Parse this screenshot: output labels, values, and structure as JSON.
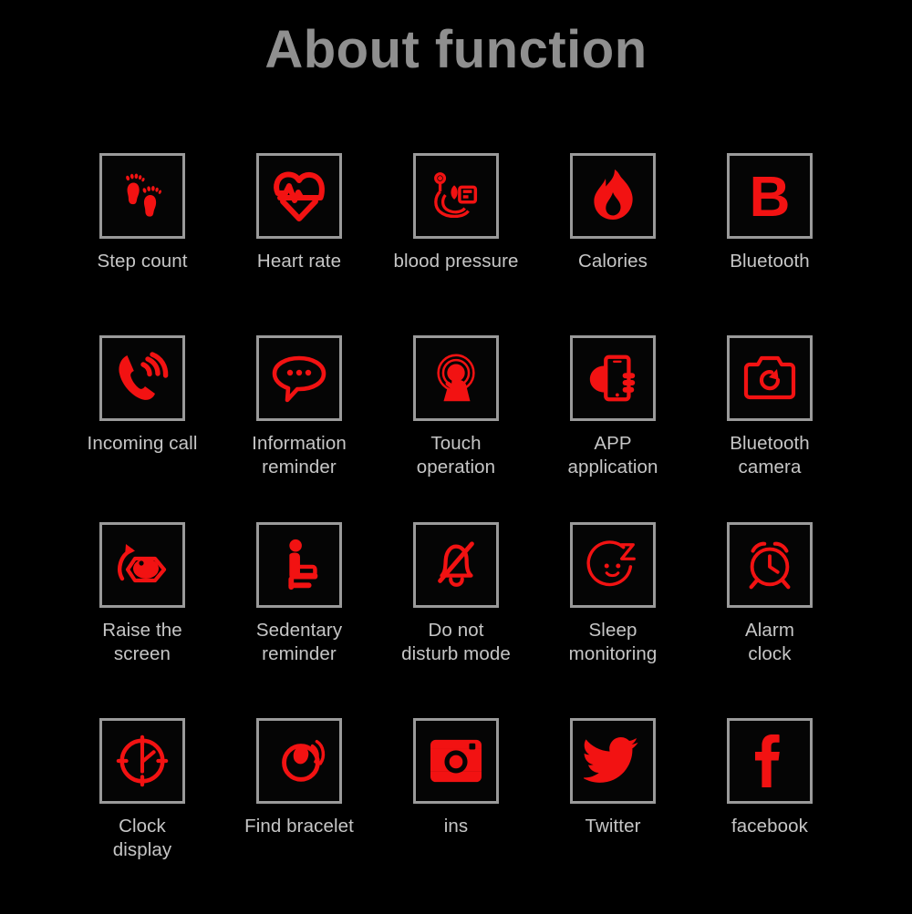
{
  "page": {
    "title": "About function",
    "background_color": "#000000",
    "title_color": "#8f8f8f",
    "label_color": "#c6c6c6",
    "icon_color": "#f21212",
    "icon_border_color": "#9a9a9a"
  },
  "grid": {
    "columns": 5,
    "rows": 4,
    "items": [
      {
        "id": "step-count",
        "label": "Step count",
        "icon": "footprints-icon"
      },
      {
        "id": "heart-rate",
        "label": "Heart rate",
        "icon": "heart-pulse-icon"
      },
      {
        "id": "blood-pressure",
        "label": "blood pressure",
        "icon": "blood-pressure-monitor-icon"
      },
      {
        "id": "calories",
        "label": "Calories",
        "icon": "flame-icon"
      },
      {
        "id": "bluetooth",
        "label": "Bluetooth",
        "icon": "letter-b-icon"
      },
      {
        "id": "incoming-call",
        "label": "Incoming call",
        "icon": "ringing-phone-icon"
      },
      {
        "id": "information-reminder",
        "label": "Information\nreminder",
        "icon": "speech-bubble-icon"
      },
      {
        "id": "touch-operation",
        "label": "Touch\noperation",
        "icon": "touch-gesture-icon"
      },
      {
        "id": "app-application",
        "label": "APP\napplication",
        "icon": "hand-holding-phone-icon"
      },
      {
        "id": "bluetooth-camera",
        "label": "Bluetooth\ncamera",
        "icon": "camera-icon"
      },
      {
        "id": "raise-the-screen",
        "label": "Raise the\nscreen",
        "icon": "eye-rotate-icon"
      },
      {
        "id": "sedentary-reminder",
        "label": "Sedentary\nreminder",
        "icon": "sitting-person-icon"
      },
      {
        "id": "do-not-disturb",
        "label": "Do not\ndisturb mode",
        "icon": "bell-muted-icon"
      },
      {
        "id": "sleep-monitoring",
        "label": "Sleep\nmonitoring",
        "icon": "sleeping-face-icon"
      },
      {
        "id": "alarm-clock",
        "label": "Alarm\nclock",
        "icon": "alarm-clock-icon"
      },
      {
        "id": "clock-display",
        "label": "Clock\ndisplay",
        "icon": "clock-face-icon"
      },
      {
        "id": "find-bracelet",
        "label": "Find bracelet",
        "icon": "vibrating-bracelet-icon"
      },
      {
        "id": "ins",
        "label": "ins",
        "icon": "instagram-icon"
      },
      {
        "id": "twitter",
        "label": "Twitter",
        "icon": "twitter-bird-icon"
      },
      {
        "id": "facebook",
        "label": "facebook",
        "icon": "facebook-f-icon"
      }
    ]
  }
}
